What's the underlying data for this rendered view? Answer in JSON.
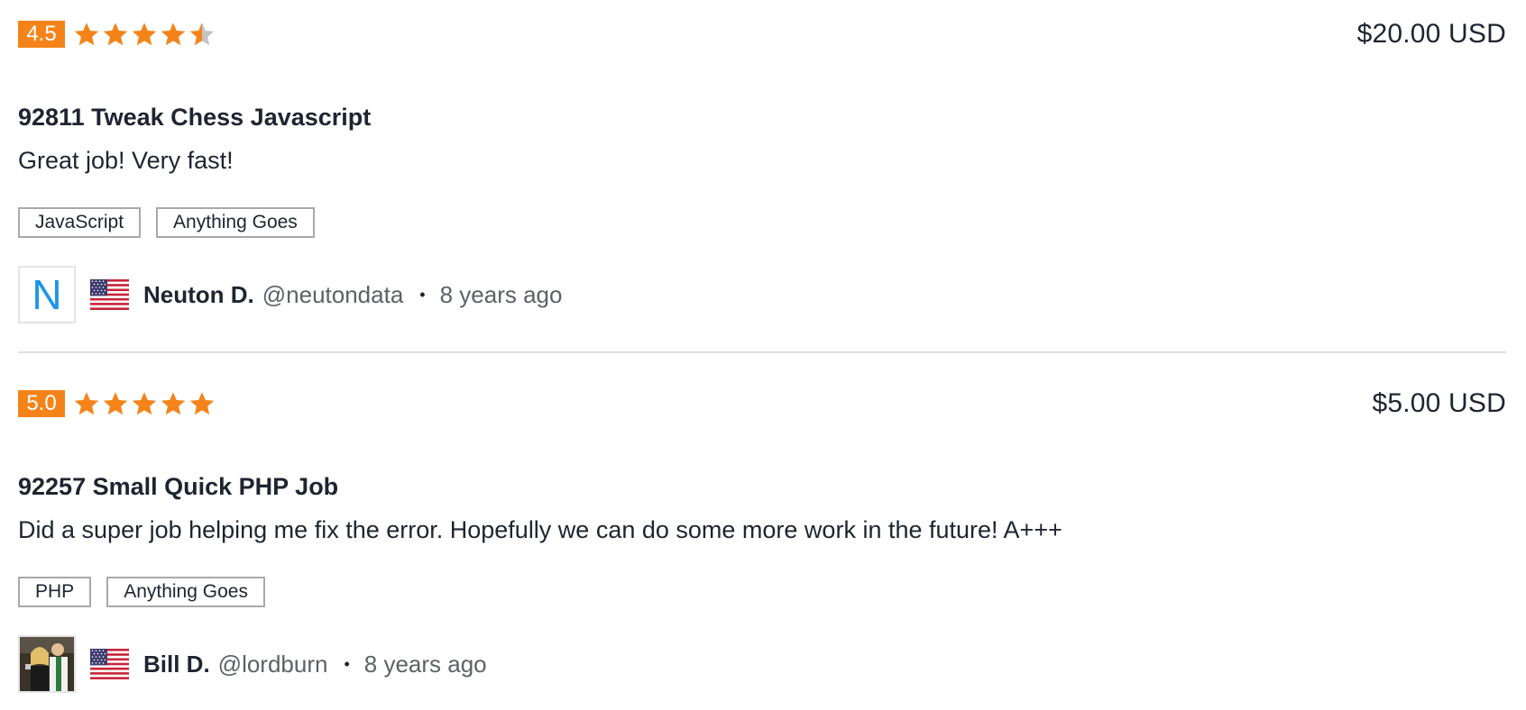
{
  "colors": {
    "accent": "#f4841a",
    "star_empty": "#c4c4c4",
    "avatar_letter": "#1c95e8",
    "divider": "#dedede"
  },
  "reviews": [
    {
      "score": "4.5",
      "star_rating": 4.5,
      "price": "$20.00 USD",
      "title": "92811 Tweak Chess Javascript",
      "comment": "Great job! Very fast!",
      "tags": [
        "JavaScript",
        "Anything Goes"
      ],
      "avatar_letter": "N",
      "flag": "us-flag-icon",
      "name": "Neuton D.",
      "handle": "@neutondata",
      "separator": "•",
      "time_ago": "8 years ago"
    },
    {
      "score": "5.0",
      "star_rating": 5,
      "price": "$5.00 USD",
      "title": "92257 Small Quick PHP Job",
      "comment": "Did a super job helping me fix the error. Hopefully we can do some more work in the future! A+++",
      "tags": [
        "PHP",
        "Anything Goes"
      ],
      "avatar_letter": "",
      "flag": "us-flag-icon",
      "name": "Bill D.",
      "handle": "@lordburn",
      "separator": "•",
      "time_ago": "8 years ago"
    }
  ]
}
